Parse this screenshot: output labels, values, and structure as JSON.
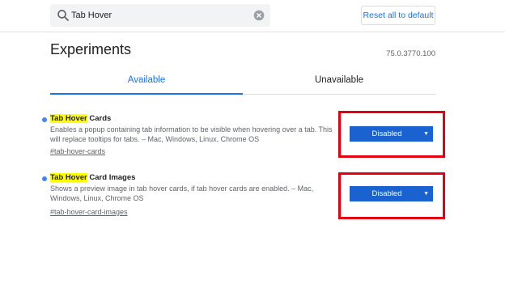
{
  "header": {
    "search": {
      "value": "Tab Hover",
      "icon": "search-icon",
      "clear_icon": "clear-icon"
    },
    "reset_label": "Reset all to default"
  },
  "title": "Experiments",
  "version": "75.0.3770.100",
  "tabs": [
    {
      "label": "Available",
      "active": true
    },
    {
      "label": "Unavailable",
      "active": false
    }
  ],
  "experiments": [
    {
      "name_highlight": "Tab Hover",
      "name_rest": " Cards",
      "description": "Enables a popup containing tab information to be visible when hovering over a tab. This will replace tooltips for tabs. – Mac, Windows, Linux, Chrome OS",
      "link": "#tab-hover-cards",
      "state": "Disabled"
    },
    {
      "name_highlight": "Tab Hover",
      "name_rest": " Card Images",
      "description": "Shows a preview image in tab hover cards, if tab hover cards are enabled. – Mac, Windows, Linux, Chrome OS",
      "link": "#tab-hover-card-images",
      "state": "Disabled"
    }
  ],
  "colors": {
    "accent": "#1a73e8",
    "select_bg": "#1a62cf",
    "highlight_box": "#e3000f",
    "search_highlight": "#ffff00",
    "bullet": "#4285f4"
  }
}
